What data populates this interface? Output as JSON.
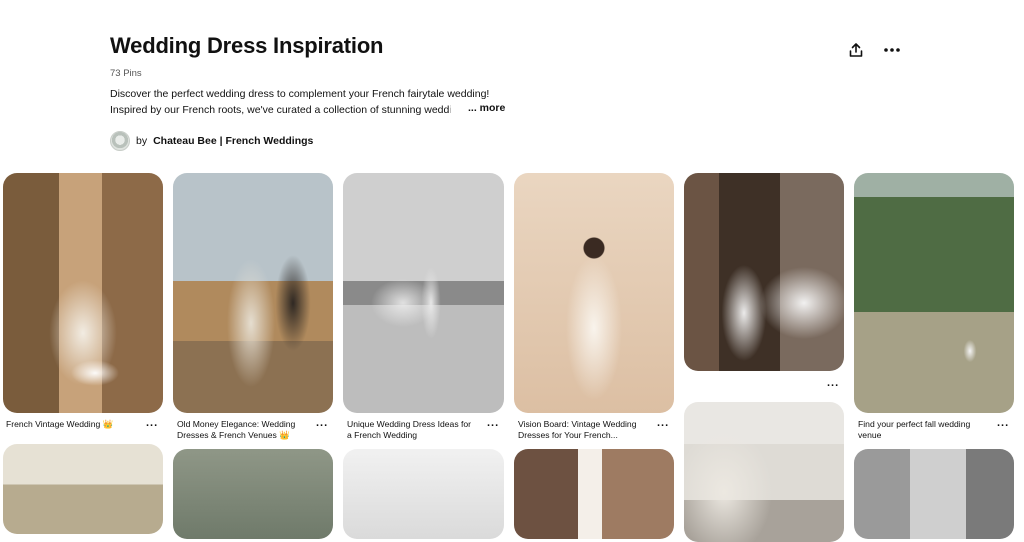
{
  "board": {
    "title": "Wedding Dress Inspiration",
    "pin_count": "73 Pins",
    "description_line1": "Discover the perfect wedding dress to complement your French fairytale wedding!",
    "description_line2": "Inspired by our French roots, we've curated a collection of stunning wedd",
    "description_fade": "i",
    "more_label": "... more",
    "owner_prefix": "by",
    "owner_name": "Chateau Bee | French Weddings"
  },
  "actions": {
    "share_icon": "share-icon",
    "more_icon": "more-icon"
  },
  "pins": [
    {
      "caption": "French Vintage Wedding 👑",
      "icon": "more-icon"
    },
    {
      "caption_line1": "Old Money Elegance: Wedding",
      "caption_line2": "Dresses & French Venues 👑"
    },
    {
      "caption_line1": "Unique Wedding Dress Ideas for",
      "caption_line2": "a French Wedding"
    },
    {
      "caption_line1": "Vision Board: Vintage Wedding",
      "caption_line2": "Dresses for Your French..."
    },
    {
      "caption": ""
    },
    {
      "caption_line1": "Find your perfect fall wedding",
      "caption_line2": "venue"
    }
  ],
  "dots_label": "..."
}
